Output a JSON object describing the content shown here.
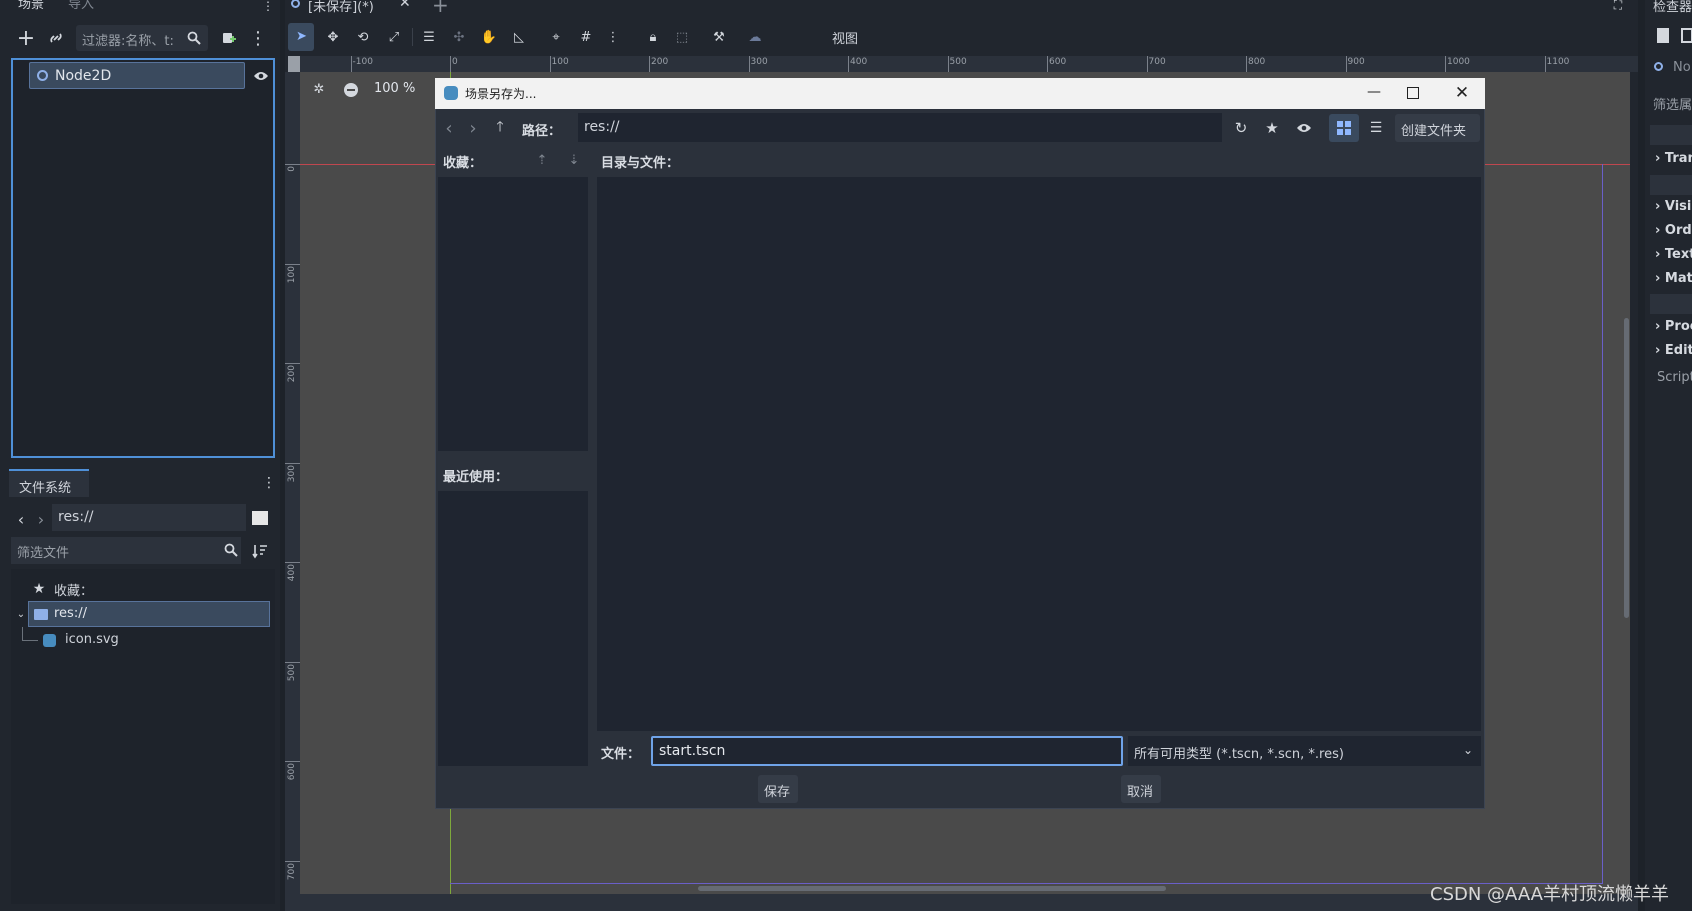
{
  "scene_dock": {
    "tabs": [
      "场景",
      "导入"
    ],
    "filter_placeholder": "过滤器:名称、t:",
    "root_node": "Node2D"
  },
  "filesystem_dock": {
    "tab": "文件系统",
    "path": "res://",
    "filter_placeholder": "筛选文件",
    "favorites_label": "收藏：",
    "tree": [
      {
        "label": "res://",
        "icon": "folder-icon",
        "selected": true
      },
      {
        "label": "icon.svg",
        "icon": "godot-icon",
        "selected": false
      }
    ]
  },
  "editor": {
    "tab_title": "[未保存](*)",
    "toolbar_view_menu": "视图",
    "zoom": "100 %",
    "ruler_marks": [
      "-100",
      "0",
      "100",
      "200",
      "300",
      "400",
      "500",
      "600",
      "700",
      "800",
      "900",
      "1000",
      "1100"
    ],
    "vruler_marks": [
      "0",
      "100",
      "200",
      "300",
      "400",
      "500",
      "600",
      "700"
    ]
  },
  "dialog": {
    "title": "场景另存为...",
    "path_label": "路径：",
    "path_value": "res://",
    "create_folder": "创建文件夹",
    "favorites_label": "收藏：",
    "recent_label": "最近使用：",
    "dirs_label": "目录与文件：",
    "file_label": "文件：",
    "file_value": "start.tscn",
    "filter_value": "所有可用类型 (*.tscn, *.scn, *.res)",
    "save_button": "保存",
    "cancel_button": "取消"
  },
  "inspector": {
    "tab": "检查器",
    "node_label": "No",
    "filter_label": "筛选属",
    "sections": [
      "Tran",
      "Visil",
      "Orde",
      "Text",
      "Mat",
      "Proc",
      "Edit"
    ],
    "script_label": "Script"
  },
  "watermark": "CSDN @AAA羊村顶流懒羊羊"
}
